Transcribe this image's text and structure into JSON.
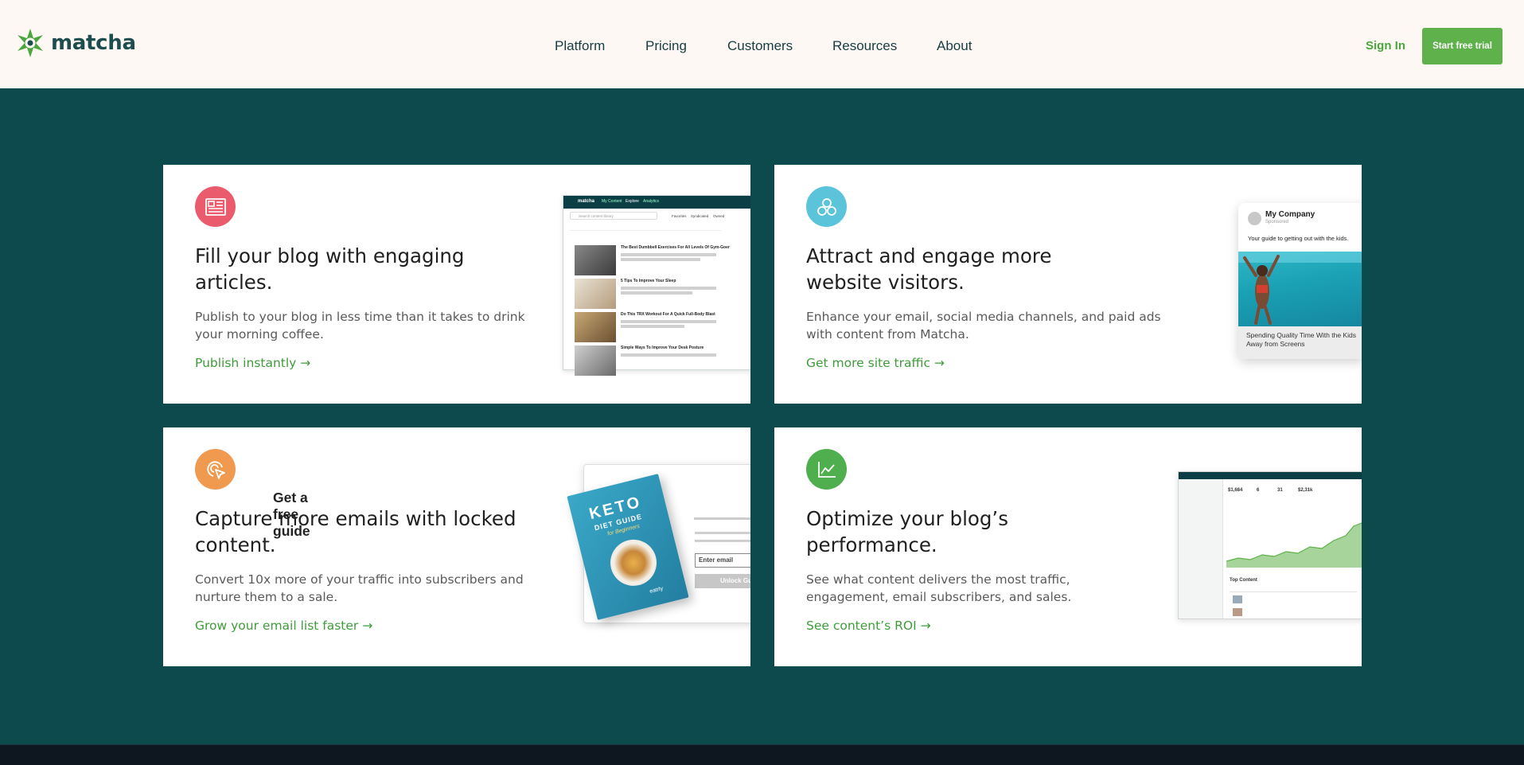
{
  "header": {
    "logo_text": "matcha",
    "nav": [
      {
        "label": "Platform"
      },
      {
        "label": "Pricing"
      },
      {
        "label": "Customers"
      },
      {
        "label": "Resources"
      },
      {
        "label": "About"
      }
    ],
    "signin_label": "Sign In",
    "trial_label": "Start free trial"
  },
  "colors": {
    "brand_dark": "#0c4a4e",
    "accent_green": "#5fb14b",
    "header_bg": "#fdf8f4"
  },
  "cards": [
    {
      "icon": "article-icon",
      "icon_color": "#ea5b6e",
      "title": "Fill your blog with engaging articles.",
      "description": "Publish to your blog in less time than it takes to drink your morning coffee.",
      "link": "Publish instantly →",
      "mockup": {
        "brand": "matcha",
        "tabs": [
          "My Content",
          "Explore",
          "Analytics"
        ],
        "search_placeholder": "Search content library",
        "filters": [
          "Favorites",
          "Syndicated",
          "Owned"
        ],
        "articles": [
          "The Best Dumbbell Exercises For All Levels Of Gym-Goer",
          "5 Tips To Improve Your Sleep",
          "Do This TRX Workout For A Quick Full-Body Blast",
          "Simple Ways To Improve Your Desk Posture"
        ]
      }
    },
    {
      "icon": "audience-icon",
      "icon_color": "#5bc3da",
      "title": "Attract and engage more website visitors.",
      "description": "Enhance your email, social media channels, and paid ads with content from Matcha.",
      "link": "Get more site traffic →",
      "mockup": {
        "company": "My Company",
        "sponsored": "Sponsored",
        "post_text": "Your guide to getting out with the kids.",
        "caption": "Spending Quality Time With the Kids Away from Screens"
      }
    },
    {
      "icon": "target-cursor-icon",
      "icon_color": "#f09a4f",
      "title": "Capture more emails with locked content.",
      "description": "Convert 10x more of your traffic into subscribers and nurture them to a sale.",
      "link": "Grow your email list faster →",
      "mockup": {
        "book_title": "KETO",
        "book_subtitle": "DIET GUIDE",
        "book_tag": "for Beginners",
        "book_brand": "eatrly",
        "headline": "Get a free guide",
        "input_placeholder": "Enter email",
        "button": "Unlock Guide"
      }
    },
    {
      "icon": "line-chart-icon",
      "icon_color": "#4fae4e",
      "title": "Optimize your blog’s performance.",
      "description": "See what content delivers the most traffic, engagement, email subscribers, and sales.",
      "link": "See content’s ROI →",
      "mockup": {
        "stats": [
          "$1,684",
          "6",
          "31",
          "$2,31k"
        ],
        "section": "Top Content"
      }
    }
  ]
}
